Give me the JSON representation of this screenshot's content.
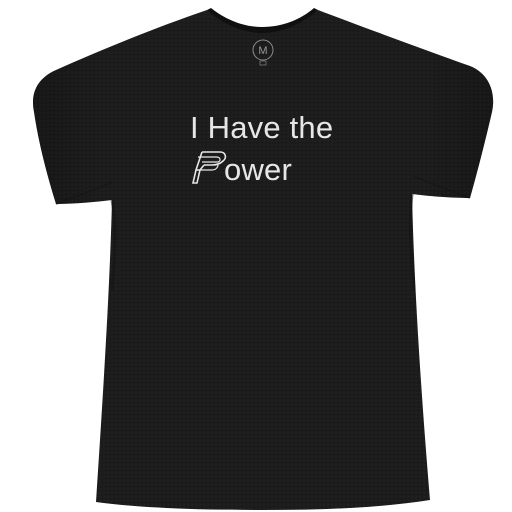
{
  "product": {
    "garment": "t-shirt",
    "shirt_color": "#1c1c1c",
    "print_color": "#e6e6e6",
    "background_color": "#ffffff"
  },
  "print": {
    "line1": "I Have the",
    "line2": "ower",
    "logo_letter": "P"
  },
  "neck_label": {
    "letter": "M"
  },
  "icons": {
    "p_logo": "stylized-p-logo-icon",
    "neck_label": "brand-neck-label-icon"
  }
}
